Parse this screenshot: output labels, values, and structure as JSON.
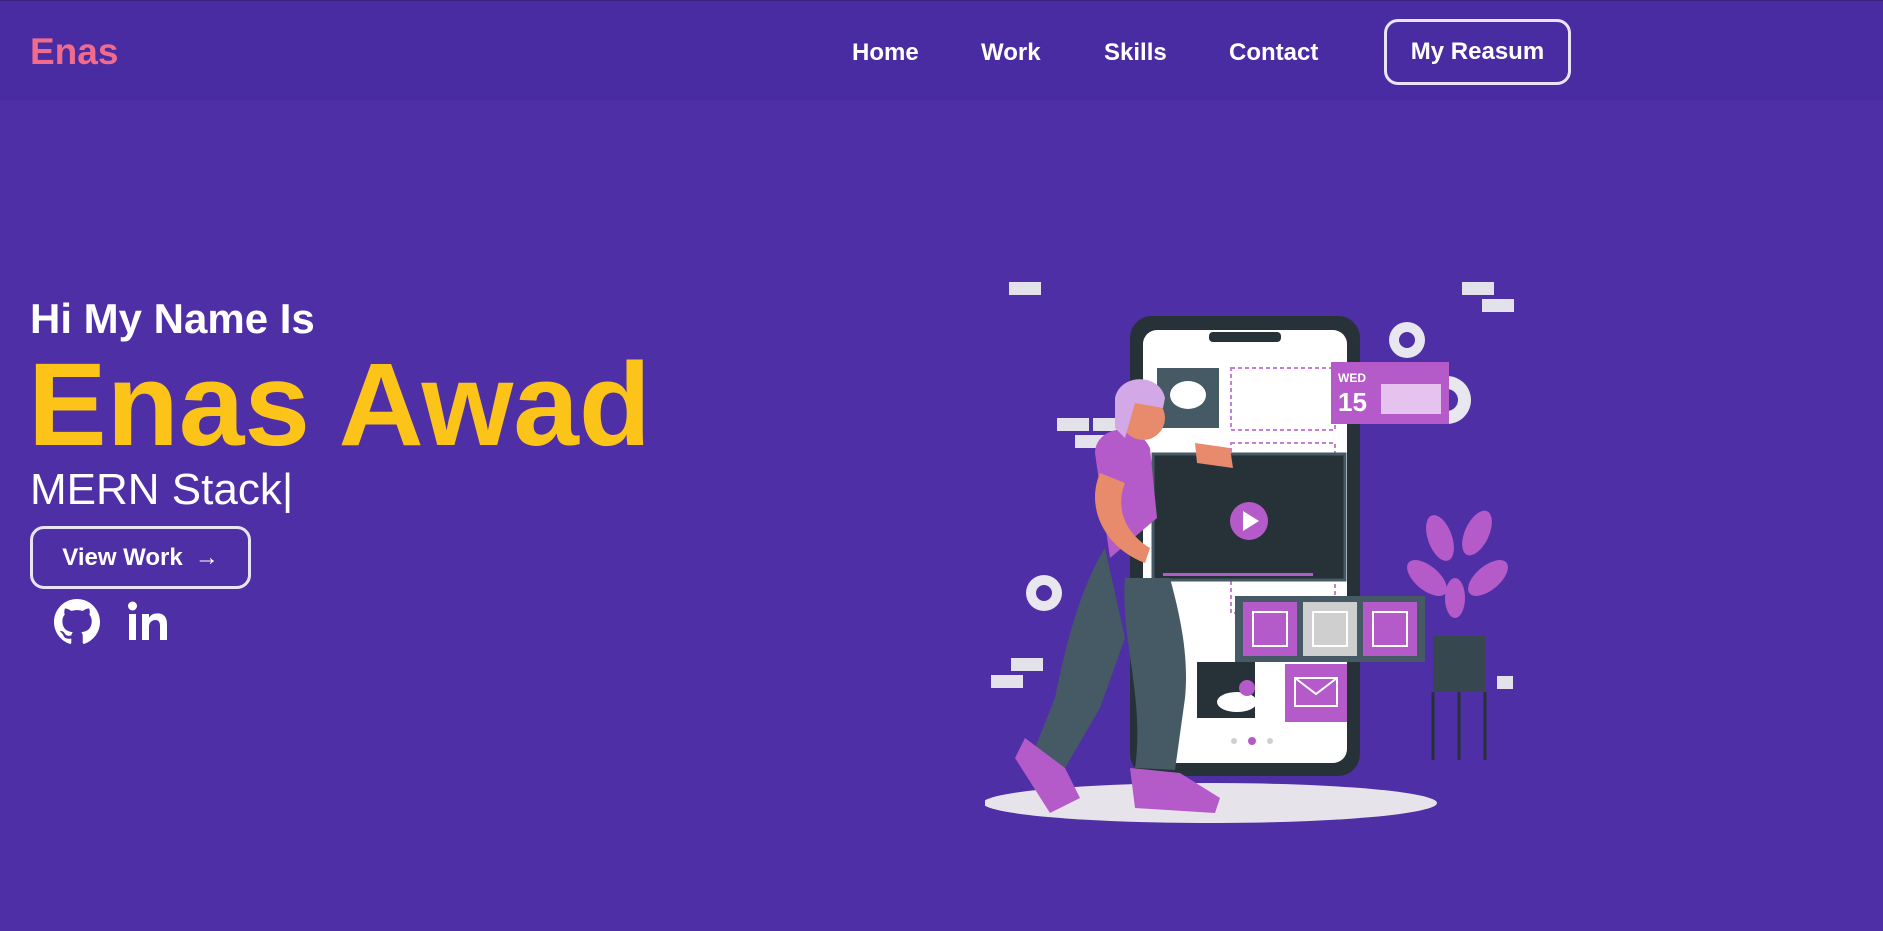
{
  "brand": {
    "logo": "Enas",
    "accent": "#f06b8c"
  },
  "nav": {
    "links": [
      "Home",
      "Work",
      "Skills",
      "Contact"
    ],
    "resume_label": "My Reasum"
  },
  "hero": {
    "greeting": "Hi My Name Is",
    "name": "Enas Awad",
    "name_color": "#fcc419",
    "role": "MERN Stack|",
    "cta_label": "View Work",
    "cta_icon": "arrow-right-icon",
    "social": [
      "github-icon",
      "linkedin-icon"
    ]
  },
  "illustration": {
    "description_icon": "developer-phone-illustration",
    "calendar_day": "WED",
    "calendar_date": "15"
  },
  "colors": {
    "background": "#4f2fa6",
    "navbar": "#4a2ca2",
    "text": "#ffffff"
  }
}
